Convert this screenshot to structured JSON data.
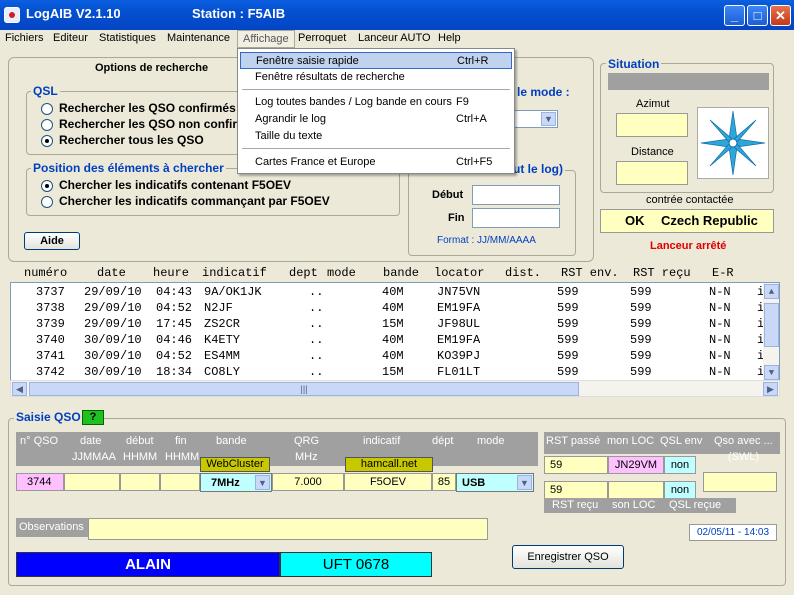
{
  "window": {
    "title": "LogAIB  V2.1.10",
    "station": "Station : F5AIB",
    "min": "_",
    "max": "□",
    "close": "✕"
  },
  "menu": [
    "Fichiers",
    "Editeur",
    "Statistiques",
    "Maintenance",
    "Affichage",
    "Perroquet",
    "Lanceur AUTO",
    "Help"
  ],
  "dropdown": [
    {
      "label": "Fenêtre saisie rapide",
      "shortcut": "Ctrl+R"
    },
    {
      "label": "Fenêtre résultats de recherche",
      "shortcut": ""
    },
    {
      "label": "Log toutes bandes / Log bande en cours",
      "shortcut": "F9"
    },
    {
      "label": "Agrandir le log",
      "shortcut": "Ctrl+A"
    },
    {
      "label": "Taille du texte",
      "shortcut": ""
    },
    {
      "label": "Cartes France et Europe",
      "shortcut": "Ctrl+F5"
    }
  ],
  "search": {
    "title": "Options de recherche",
    "qsl_title": "QSL",
    "qsl_options": [
      "Rechercher les QSO confirmés",
      "Rechercher les QSO non confirmés",
      "Rechercher tous les QSO"
    ],
    "pos_title": "Position des éléments à chercher",
    "pos_options": [
      "Chercher les indicatifs contenant F5OEV",
      "Chercher les indicatifs commançant par F5OEV"
    ],
    "help": "Aide",
    "mode_title": "le mode :",
    "log_title": "ut le log)",
    "debut": "Début",
    "fin": "Fin",
    "format": "Format : JJ/MM/AAAA"
  },
  "situation": {
    "title": "Situation",
    "azimut": "Azimut",
    "distance": "Distance",
    "contree_label": "contrée contactée",
    "contree_status": "OK",
    "contree_value": "Czech Republic",
    "lanceur": "Lanceur arrêté"
  },
  "table": {
    "headers": [
      "numéro",
      "date",
      "heure",
      "indicatif",
      "dept",
      "mode",
      "bande",
      "locator",
      "dist.",
      "RST env.",
      "RST reçu",
      "E-R"
    ],
    "rows": [
      [
        "3737",
        "29/09/10",
        "04:43",
        "9A/OK1JK",
        "..",
        "40M",
        "JN75VN",
        "599",
        "599",
        "N-N",
        "i"
      ],
      [
        "3738",
        "29/09/10",
        "04:52",
        "N2JF",
        "..",
        "40M",
        "EM19FA",
        "599",
        "599",
        "N-N",
        "i"
      ],
      [
        "3739",
        "29/09/10",
        "17:45",
        "ZS2CR",
        "..",
        "15M",
        "JF98UL",
        "599",
        "599",
        "N-N",
        "i"
      ],
      [
        "3740",
        "30/09/10",
        "04:46",
        "K4ETY",
        "..",
        "40M",
        "EM19FA",
        "599",
        "599",
        "N-N",
        "i"
      ],
      [
        "3741",
        "30/09/10",
        "04:52",
        "ES4MM",
        "..",
        "40M",
        "KO39PJ",
        "599",
        "599",
        "N-N",
        "i"
      ],
      [
        "3742",
        "30/09/10",
        "18:34",
        "CO8LY",
        "..",
        "15M",
        "FL01LT",
        "599",
        "599",
        "N-N",
        "i"
      ]
    ]
  },
  "saisie": {
    "title": "Saisie QSO",
    "qmark": "?",
    "headers": {
      "nqso": "n° QSO",
      "date": "date",
      "date_fmt": "JJMMAA",
      "debut": "début",
      "debut_fmt": "HHMM",
      "fin": "fin",
      "fin_fmt": "HHMM",
      "bande": "bande",
      "qrg": "QRG",
      "qrg_unit": "MHz",
      "indicatif": "indicatif",
      "dept": "dépt",
      "mode": "mode",
      "rst_passe": "RST passé",
      "mon_loc": "mon LOC",
      "qsl_env": "QSL env",
      "qso_avec": "Qso avec ...",
      "swl": "(SWL)",
      "rst_recu": "RST reçu",
      "son_loc": "son LOC",
      "qsl_recue": "QSL reçue"
    },
    "values": {
      "nqso": "3744",
      "bande": "7MHz",
      "qrg": "7.000",
      "indicatif": "F5OEV",
      "dept": "85",
      "mode": "USB",
      "rst_passe": "59",
      "mon_loc": "JN29VM",
      "qsl_env": "non",
      "rst_recu": "59",
      "qsl_recue": "non"
    },
    "webcluster": "WebCluster",
    "hamcall": "hamcall.net",
    "observations": "Observations",
    "datetime": "02/05/11 - 14:03",
    "name": "ALAIN",
    "loc": "UFT 0678",
    "save": "Enregistrer QSO"
  },
  "colors": {
    "title_blue": "#0450d0",
    "header_gray": "#a0a0a0",
    "field_yellow": "#ffffc0",
    "accent_blue": "#003fc0",
    "red": "#e00000"
  }
}
